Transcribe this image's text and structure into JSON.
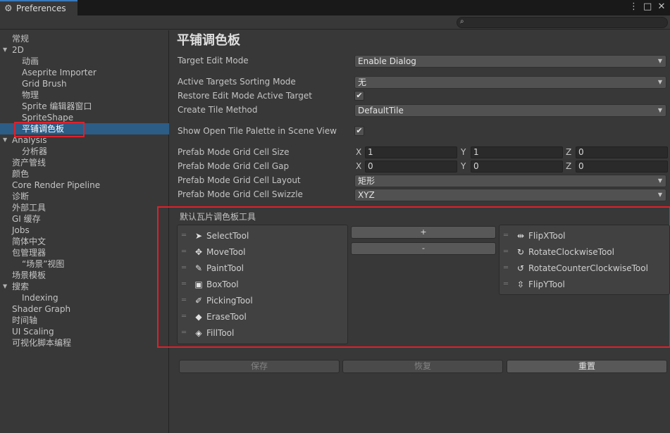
{
  "window": {
    "tab_title": "Preferences",
    "controls": [
      "⋮",
      "□",
      "✕"
    ]
  },
  "search": {
    "placeholder": ""
  },
  "sidebar": {
    "items": [
      {
        "label": "常规",
        "indent": 0,
        "arrow": ""
      },
      {
        "label": "2D",
        "indent": 0,
        "arrow": "▼"
      },
      {
        "label": "动画",
        "indent": 1,
        "arrow": ""
      },
      {
        "label": "Aseprite Importer",
        "indent": 1,
        "arrow": ""
      },
      {
        "label": "Grid Brush",
        "indent": 1,
        "arrow": ""
      },
      {
        "label": "物理",
        "indent": 1,
        "arrow": ""
      },
      {
        "label": "Sprite 编辑器窗口",
        "indent": 1,
        "arrow": ""
      },
      {
        "label": "SpriteShape",
        "indent": 1,
        "arrow": ""
      },
      {
        "label": "平铺调色板",
        "indent": 1,
        "arrow": "",
        "selected": true
      },
      {
        "label": "Analysis",
        "indent": 0,
        "arrow": "▼"
      },
      {
        "label": "分析器",
        "indent": 1,
        "arrow": ""
      },
      {
        "label": "资产管线",
        "indent": 0,
        "arrow": ""
      },
      {
        "label": "颜色",
        "indent": 0,
        "arrow": ""
      },
      {
        "label": "Core Render Pipeline",
        "indent": 0,
        "arrow": ""
      },
      {
        "label": "诊断",
        "indent": 0,
        "arrow": ""
      },
      {
        "label": "外部工具",
        "indent": 0,
        "arrow": ""
      },
      {
        "label": "GI 缓存",
        "indent": 0,
        "arrow": ""
      },
      {
        "label": "Jobs",
        "indent": 0,
        "arrow": ""
      },
      {
        "label": "简体中文",
        "indent": 0,
        "arrow": ""
      },
      {
        "label": "包管理器",
        "indent": 0,
        "arrow": ""
      },
      {
        "label": "“场景”视图",
        "indent": 1,
        "arrow": ""
      },
      {
        "label": "场景模板",
        "indent": 0,
        "arrow": ""
      },
      {
        "label": "搜索",
        "indent": 0,
        "arrow": "▼"
      },
      {
        "label": "Indexing",
        "indent": 1,
        "arrow": ""
      },
      {
        "label": "Shader Graph",
        "indent": 0,
        "arrow": ""
      },
      {
        "label": "时间轴",
        "indent": 0,
        "arrow": ""
      },
      {
        "label": "UI Scaling",
        "indent": 0,
        "arrow": ""
      },
      {
        "label": "可视化脚本编程",
        "indent": 0,
        "arrow": ""
      }
    ]
  },
  "main": {
    "title": "平铺调色板",
    "target_edit_mode": {
      "label": "Target Edit Mode",
      "value": "Enable Dialog"
    },
    "active_targets_sorting_mode": {
      "label": "Active Targets Sorting Mode",
      "value": "无"
    },
    "restore_edit_mode": {
      "label": "Restore Edit Mode Active Target",
      "checked": "✔"
    },
    "create_tile_method": {
      "label": "Create Tile Method",
      "value": "DefaultTile"
    },
    "show_open_tile_palette": {
      "label": "Show Open Tile Palette in Scene View",
      "checked": "✔"
    },
    "cell_size": {
      "label": "Prefab Mode Grid Cell Size",
      "x": "1",
      "y": "1",
      "z": "0"
    },
    "cell_gap": {
      "label": "Prefab Mode Grid Cell Gap",
      "x": "0",
      "y": "0",
      "z": "0"
    },
    "cell_layout": {
      "label": "Prefab Mode Grid Cell Layout",
      "value": "矩形"
    },
    "cell_swizzle": {
      "label": "Prefab Mode Grid Cell Swizzle",
      "value": "XYZ"
    },
    "axis": {
      "x": "X",
      "y": "Y",
      "z": "Z"
    },
    "tools_section": {
      "title": "默认瓦片调色板工具",
      "left_tools": [
        {
          "label": "SelectTool",
          "icon": "➤",
          "icon_name": "select-arrow-icon"
        },
        {
          "label": "MoveTool",
          "icon": "✥",
          "icon_name": "move-cross-icon"
        },
        {
          "label": "PaintTool",
          "icon": "✎",
          "icon_name": "paint-brush-icon"
        },
        {
          "label": "BoxTool",
          "icon": "▣",
          "icon_name": "box-fill-icon"
        },
        {
          "label": "PickingTool",
          "icon": "✐",
          "icon_name": "eyedropper-icon"
        },
        {
          "label": "EraseTool",
          "icon": "◆",
          "icon_name": "eraser-icon"
        },
        {
          "label": "FillTool",
          "icon": "◈",
          "icon_name": "paint-bucket-icon"
        }
      ],
      "right_tools": [
        {
          "label": "FlipXTool",
          "icon": "⇹",
          "icon_name": "flip-x-icon"
        },
        {
          "label": "RotateClockwiseTool",
          "icon": "↻",
          "icon_name": "rotate-clockwise-icon"
        },
        {
          "label": "RotateCounterClockwiseTool",
          "icon": "↺",
          "icon_name": "rotate-counter-clockwise-icon"
        },
        {
          "label": "FlipYTool",
          "icon": "⇳",
          "icon_name": "flip-y-icon"
        }
      ],
      "add_label": "+",
      "remove_label": "-",
      "grip": "═"
    },
    "buttons": {
      "save": "保存",
      "revert": "恢复",
      "reset": "重置"
    }
  }
}
